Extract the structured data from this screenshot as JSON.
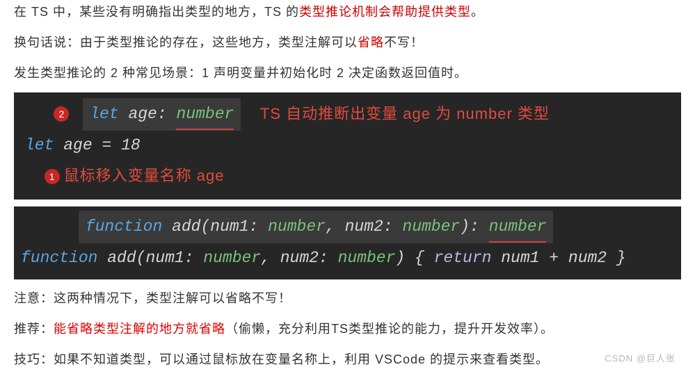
{
  "paras": {
    "p1_a": "在 TS 中，某些没有明确指出类型的地方，TS 的",
    "p1_red": "类型推论机制会帮助提供类型",
    "p1_b": "。",
    "p2_a": "换句话说：由于类型推论的存在，这些地方，类型注解可以",
    "p2_red": "省略",
    "p2_b": "不写！",
    "p3": "发生类型推论的 2 种常见场景：1  声明变量并初始化时   2 决定函数返回值时。",
    "p4": "注意：这两种情况下，类型注解可以省略不写！",
    "p5_a": "推荐：",
    "p5_red": "能省略类型注解的地方就省略",
    "p5_b": "（偷懒，充分利用TS类型推论的能力，提升开发效率）。",
    "p6": "技巧：如果不知道类型，可以通过鼠标放在变量名称上，利用 VSCode 的提示来查看类型。"
  },
  "code1": {
    "badge2": "2",
    "badge1": "1",
    "tooltip_let": "let ",
    "tooltip_var": "age",
    "tooltip_colon": ": ",
    "tooltip_type": "number",
    "tooltip_comment": "TS 自动推断出变量 age 为 number 类型",
    "line_let": "let ",
    "line_var": "age",
    "line_op": " = ",
    "line_val": "18",
    "hover_comment": "鼠标移入变量名称 age"
  },
  "code2": {
    "tooltip_fn": "function ",
    "tooltip_name": "add",
    "tooltip_lp": "(",
    "tooltip_p1": "num1",
    "tooltip_c": ": ",
    "tooltip_t": "number",
    "tooltip_cm": ", ",
    "tooltip_p2": "num2",
    "tooltip_rp": ")",
    "tooltip_rc": ": ",
    "tooltip_rt": "number",
    "main_fn": "function ",
    "main_name": "add",
    "main_lp": "(",
    "main_p1": "num1",
    "main_c": ": ",
    "main_t": "number",
    "main_cm": ", ",
    "main_p2": "num2",
    "main_rp": ")",
    "main_ob": " { ",
    "main_ret": "return ",
    "main_e1": "num1",
    "main_plus": " + ",
    "main_e2": "num2",
    "main_cb": " }"
  },
  "watermark": "CSDN @巨人张"
}
